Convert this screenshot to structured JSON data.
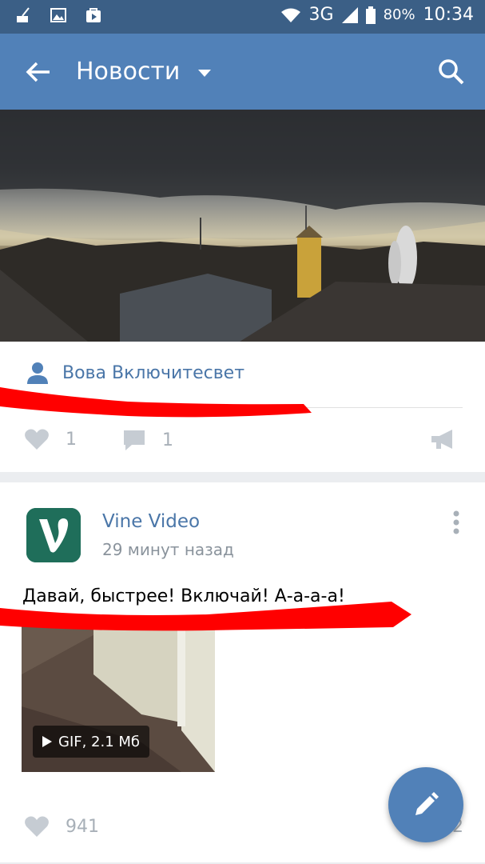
{
  "status_bar": {
    "network": "3G",
    "battery": "80%",
    "time": "10:34"
  },
  "app_bar": {
    "title": "Новости"
  },
  "post1": {
    "author": "Вова Включитесвет",
    "likes": "1",
    "comments": "1"
  },
  "post2": {
    "author": "Vine Video",
    "time_ago": "29 минут назад",
    "text": "Давай, быстрее! Включай! А-а-а-а!",
    "media_badge": "GIF, 2.1 Мб",
    "likes": "941",
    "comments_partial": "2"
  },
  "colors": {
    "status_bar": "#3b5f86",
    "app_bar": "#5181b8",
    "link": "#4a76a8",
    "icon_gray": "#a8b0b8",
    "annotation_red": "#ff0000"
  }
}
